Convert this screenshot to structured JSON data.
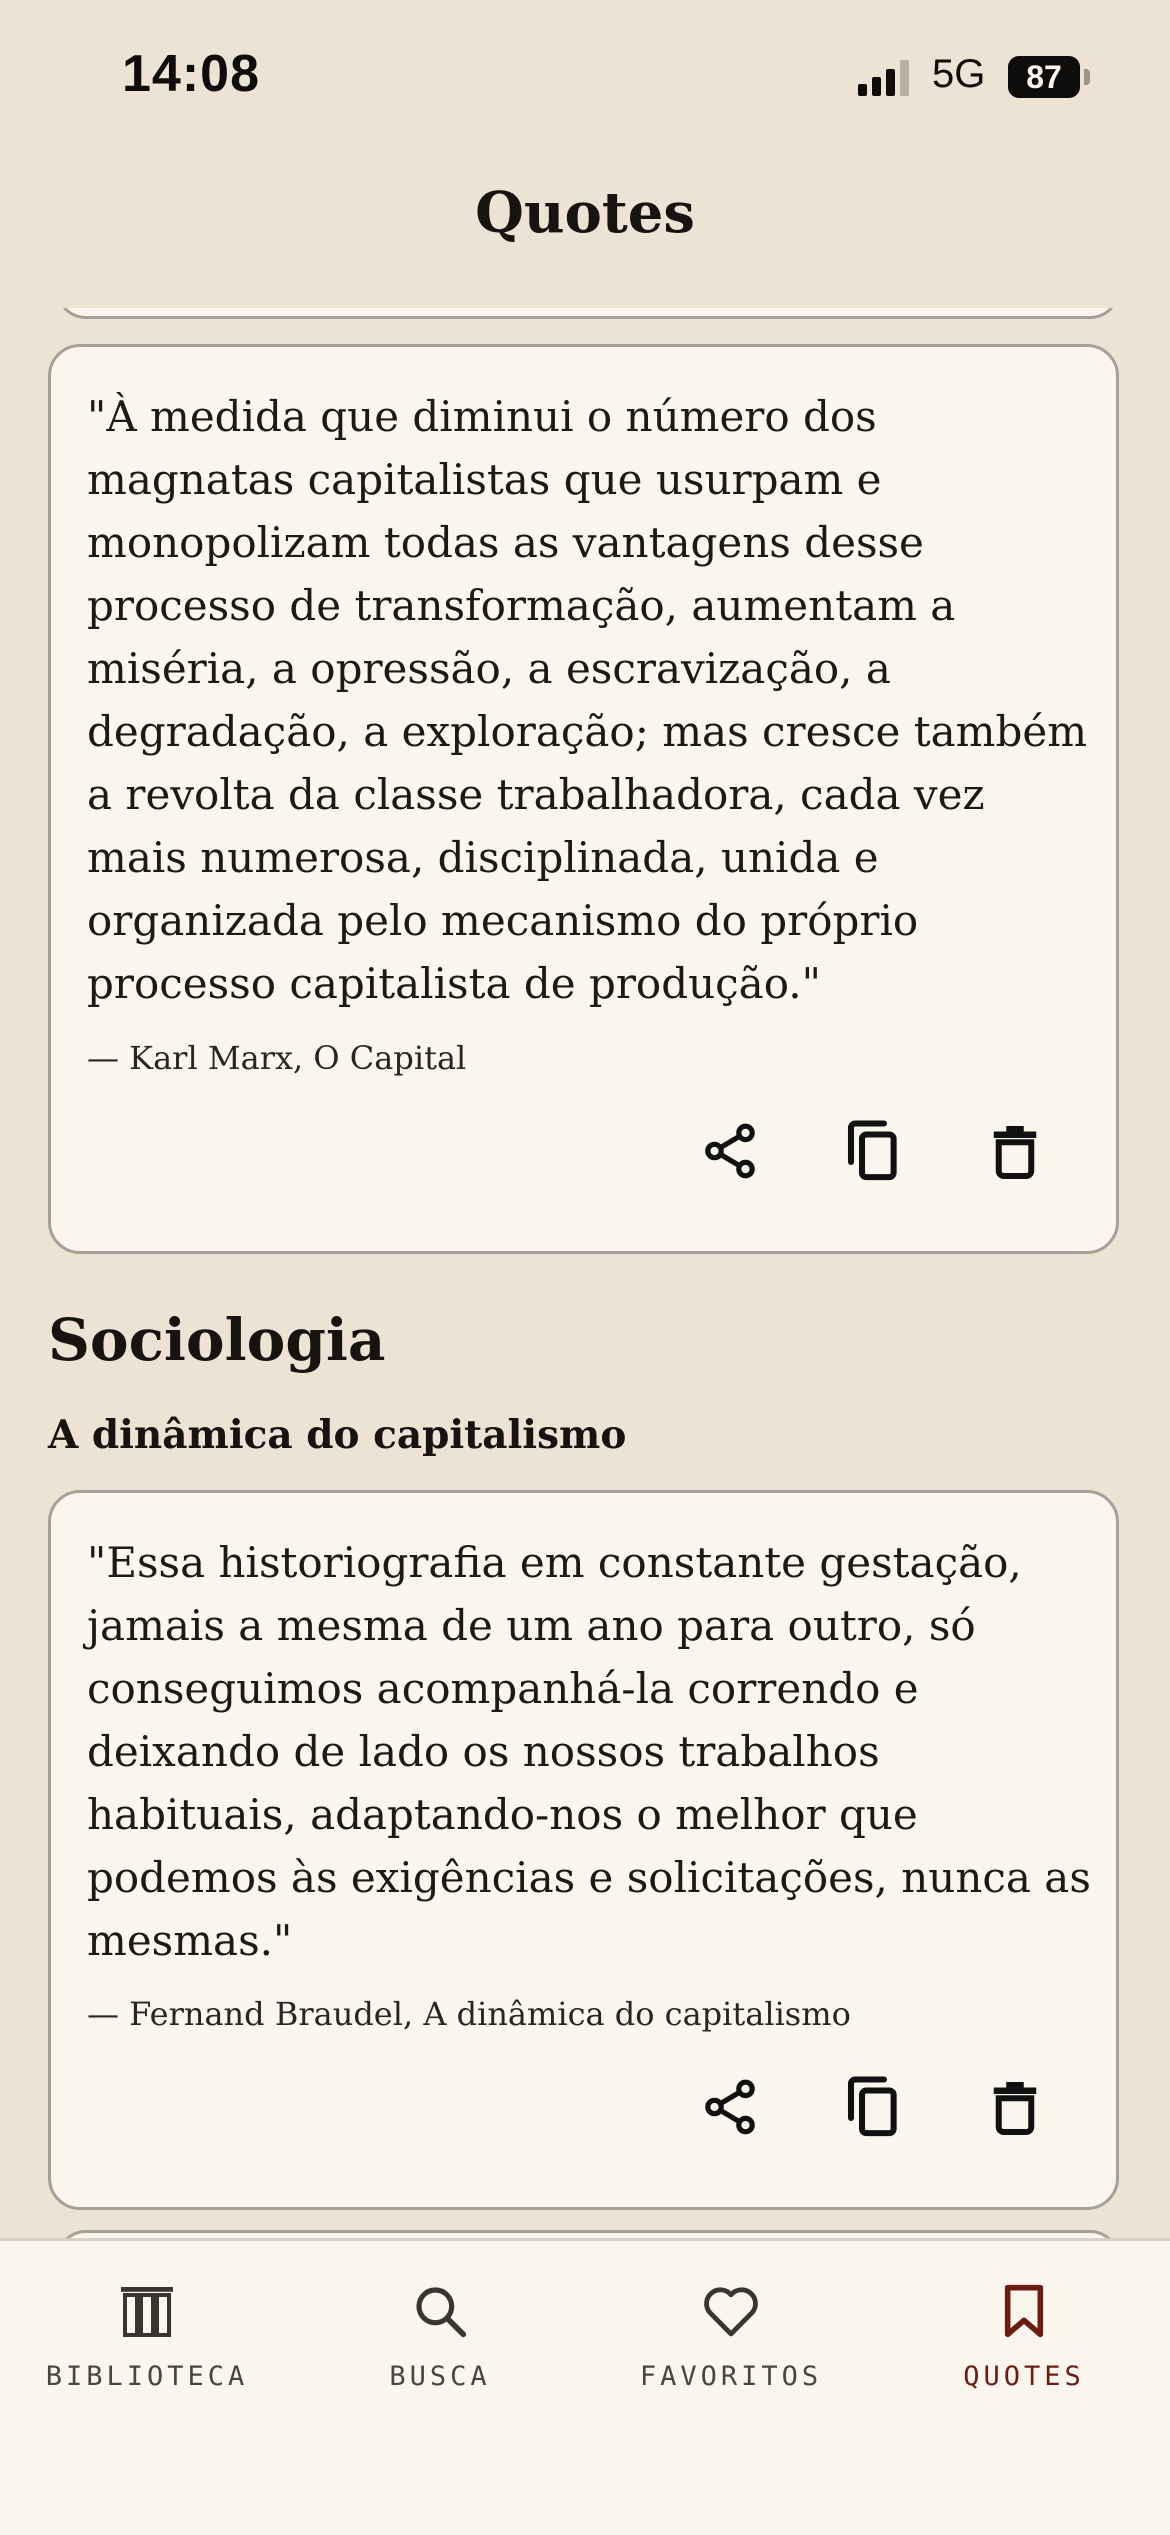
{
  "status_bar": {
    "time": "14:08",
    "network": "5G",
    "battery": "87"
  },
  "header": {
    "title": "Quotes"
  },
  "quotes": [
    {
      "text": "\"À medida que diminui o número dos magnatas capitalistas que usurpam e monopolizam todas as vantagens desse processo de transformação, aumentam a miséria, a opressão, a escravização, a degradação, a exploração; mas cresce também a revolta da classe trabalhadora, cada vez mais numerosa, disciplinada, unida e organizada pelo mecanismo do próprio processo capitalista de produção.\"",
      "attribution": "— Karl Marx, O Capital"
    },
    {
      "text": "\"Essa historiografia em constante gestação, jamais a mesma de um ano para outro, só conseguimos acompanhá-la correndo e deixando de lado os nossos trabalhos habituais, adaptando-nos o melhor que podemos às exigências e solicitações, nunca as mesmas.\"",
      "attribution": "— Fernand Braudel, A dinâmica do capitalismo"
    }
  ],
  "section": {
    "title": "Sociologia",
    "book_title": "A dinâmica do capitalismo"
  },
  "actions": {
    "share_icon": "share-icon",
    "copy_icon": "copy-icon",
    "delete_icon": "trash-icon"
  },
  "tab_bar": {
    "active": "quotes",
    "tabs": [
      {
        "id": "biblioteca",
        "label": "BIBLIOTECA",
        "icon": "books-icon"
      },
      {
        "id": "busca",
        "label": "BUSCA",
        "icon": "search-icon"
      },
      {
        "id": "favoritos",
        "label": "FAVORITOS",
        "icon": "heart-icon"
      },
      {
        "id": "quotes",
        "label": "QUOTES",
        "icon": "bookmark-icon"
      }
    ]
  },
  "colors": {
    "background": "#ede3d5",
    "card": "#fbf6ed",
    "card_border": "#a8a098",
    "accent": "#6b1d14",
    "text": "#161310"
  }
}
